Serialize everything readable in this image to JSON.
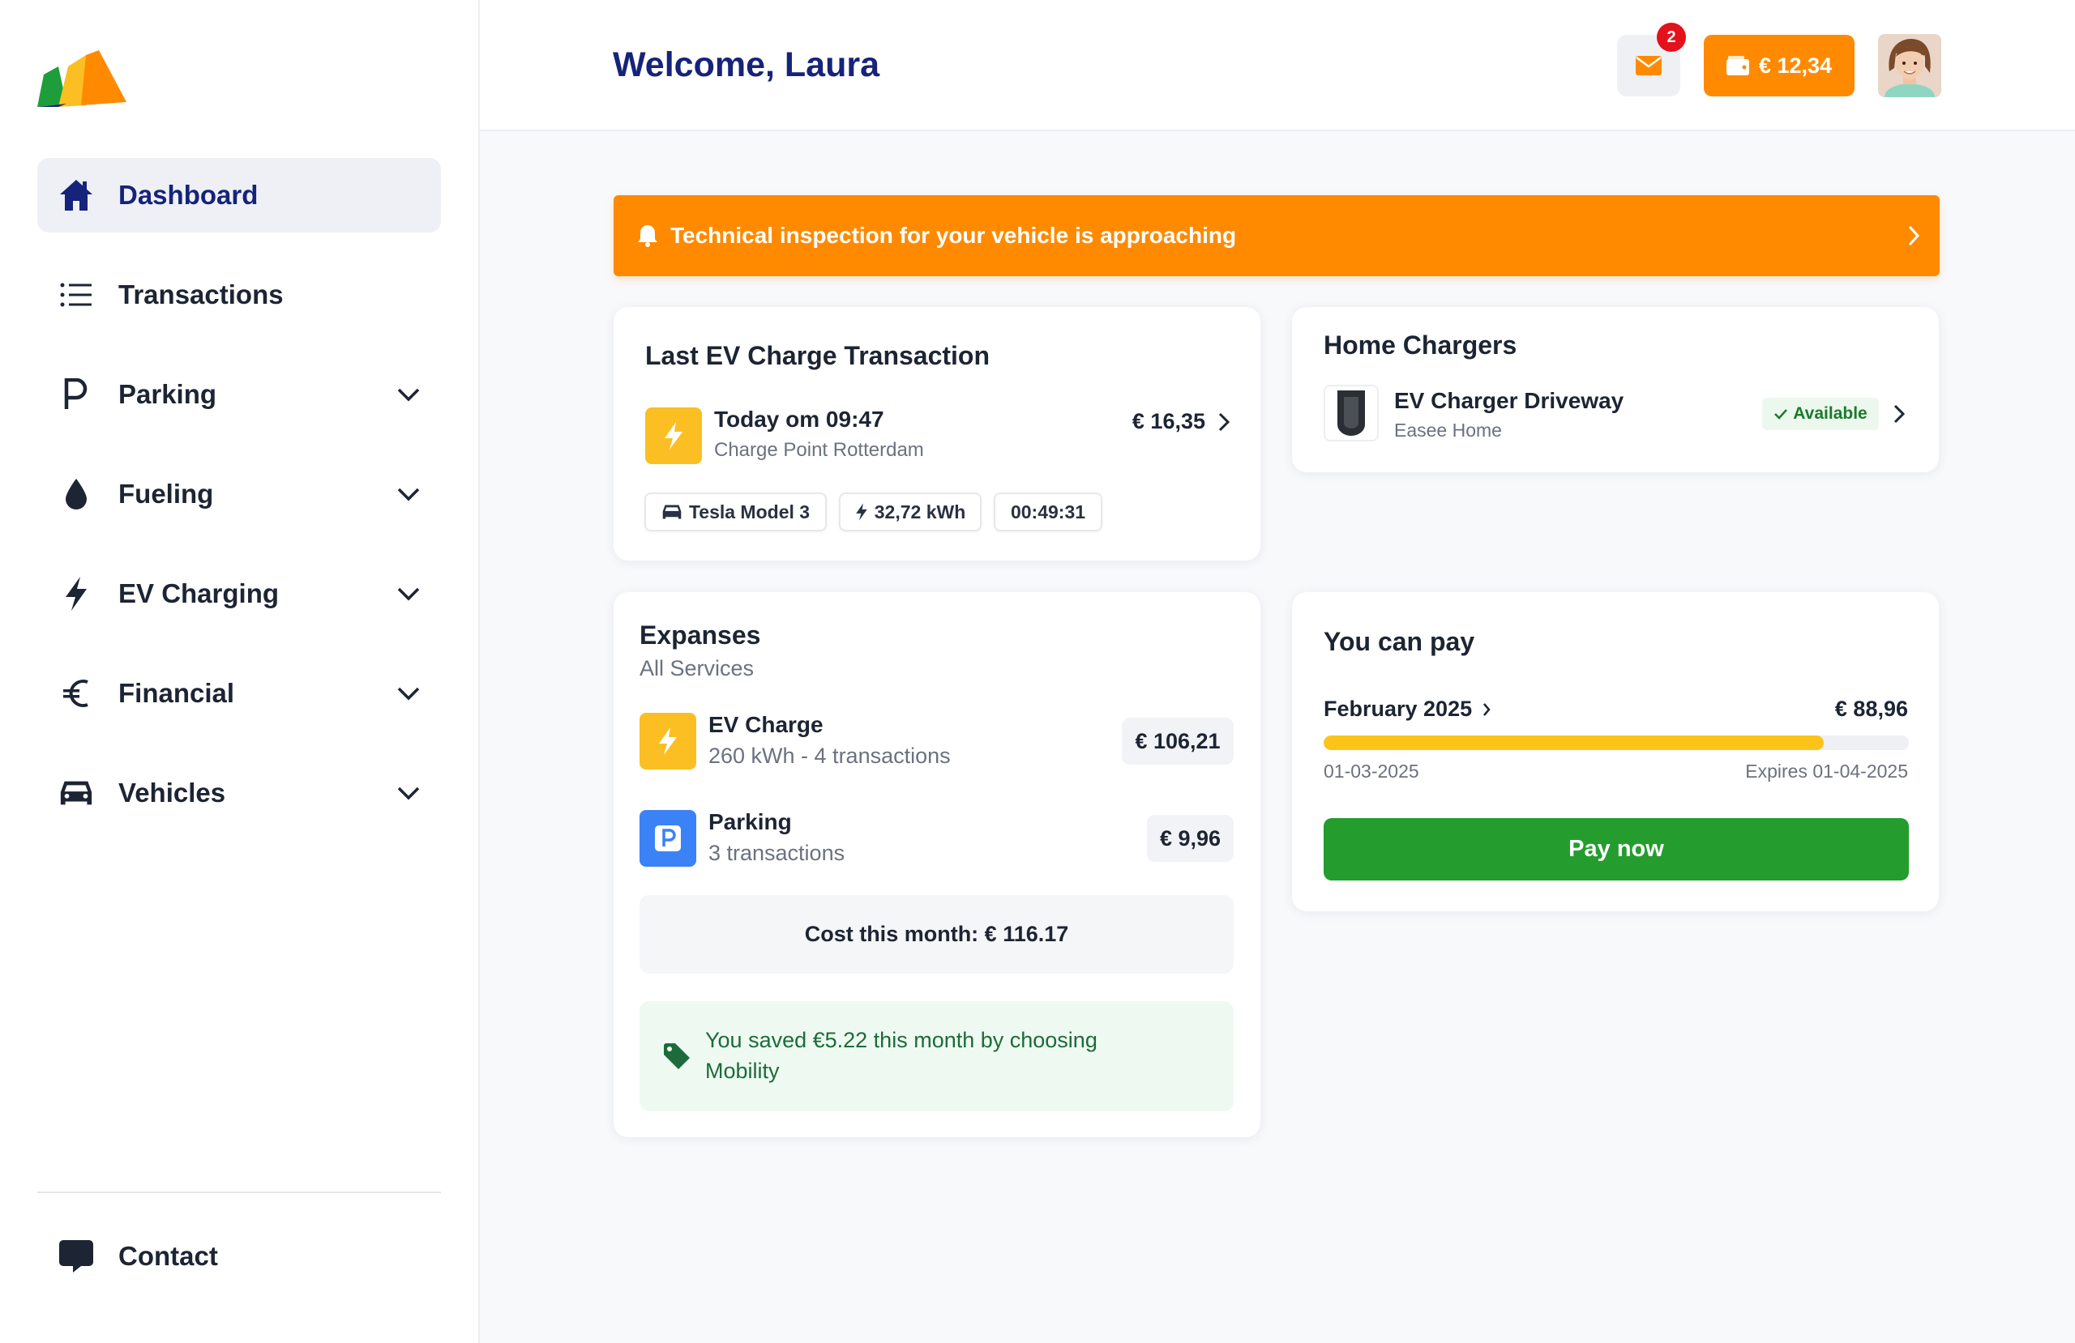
{
  "app": {
    "brand": "Mobility"
  },
  "sidebar": {
    "items": [
      {
        "label": "Dashboard",
        "icon": "home-icon",
        "active": true
      },
      {
        "label": "Transactions",
        "icon": "list-icon"
      },
      {
        "label": "Parking",
        "icon": "parking-icon",
        "expandable": true
      },
      {
        "label": "Fueling",
        "icon": "drop-icon",
        "expandable": true
      },
      {
        "label": "EV Charging",
        "icon": "bolt-icon",
        "expandable": true
      },
      {
        "label": "Financial",
        "icon": "euro-icon",
        "expandable": true
      },
      {
        "label": "Vehicles",
        "icon": "car-icon",
        "expandable": true
      }
    ],
    "contact": {
      "label": "Contact",
      "icon": "chat-icon"
    }
  },
  "header": {
    "welcome": "Welcome, Laura",
    "notifications_count": "2",
    "wallet_balance": "€ 12,34"
  },
  "banner": {
    "text": "Technical inspection for your vehicle is approaching"
  },
  "last_charge": {
    "title": "Last EV Charge Transaction",
    "date": "Today om 09:47",
    "location": "Charge Point Rotterdam",
    "amount": "€ 16,35",
    "vehicle": "Tesla Model 3",
    "energy": "32,72 kWh",
    "duration": "00:49:31"
  },
  "home_chargers": {
    "title": "Home Chargers",
    "charger_name": "EV Charger Driveway",
    "charger_model": "Easee Home",
    "status": "Available"
  },
  "expenses": {
    "title": "Expanses",
    "subtitle": "All Services",
    "items": [
      {
        "name": "EV Charge",
        "detail": "260 kWh - 4 transactions",
        "amount": "€ 106,21",
        "icon": "bolt-icon"
      },
      {
        "name": "Parking",
        "detail": "3 transactions",
        "amount": "€ 9,96",
        "icon": "parking-icon"
      }
    ],
    "cost_month": "Cost this month: € 116.17",
    "savings": "You saved €5.22 this month by choosing Mobility"
  },
  "pay": {
    "title": "You can pay",
    "period": "February 2025",
    "amount": "€ 88,96",
    "progress": 0.855,
    "start_date": "01-03-2025",
    "expires": "Expires 01-04-2025",
    "button": "Pay now"
  },
  "colors": {
    "brand_navy": "#16237a",
    "accent_orange": "#ff8a00",
    "success_green": "#249d2e",
    "progress_yellow": "#fcc419",
    "parking_blue": "#3b82f6",
    "badge_red": "#e3121b"
  }
}
